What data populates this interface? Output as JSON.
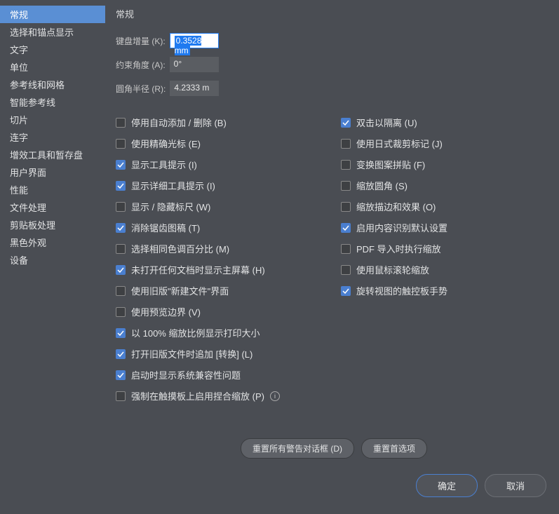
{
  "sidebar": {
    "items": [
      {
        "label": "常规",
        "active": true
      },
      {
        "label": "选择和锚点显示"
      },
      {
        "label": "文字"
      },
      {
        "label": "单位"
      },
      {
        "label": "参考线和网格"
      },
      {
        "label": "智能参考线"
      },
      {
        "label": "切片"
      },
      {
        "label": "连字"
      },
      {
        "label": "增效工具和暂存盘"
      },
      {
        "label": "用户界面"
      },
      {
        "label": "性能"
      },
      {
        "label": "文件处理"
      },
      {
        "label": "剪贴板处理"
      },
      {
        "label": "黑色外观"
      },
      {
        "label": "设备"
      }
    ]
  },
  "main": {
    "title": "常规",
    "fields": {
      "keyboard_increment_label": "键盘增量 (K):",
      "keyboard_increment_value": "0.3528 mm",
      "constrain_angle_label": "约束角度 (A):",
      "constrain_angle_value": "0°",
      "corner_radius_label": "圆角半径 (R):",
      "corner_radius_value": "4.2333 m"
    },
    "checks_left": [
      {
        "label": "停用自动添加 / 删除 (B)",
        "checked": false
      },
      {
        "label": "使用精确光标 (E)",
        "checked": false
      },
      {
        "label": "显示工具提示 (I)",
        "checked": true
      },
      {
        "label": "显示详细工具提示 (I)",
        "checked": true
      },
      {
        "label": "显示 / 隐藏标尺 (W)",
        "checked": false
      },
      {
        "label": "消除锯齿图稿 (T)",
        "checked": true
      },
      {
        "label": "选择相同色调百分比 (M)",
        "checked": false
      },
      {
        "label": "未打开任何文档时显示主屏幕 (H)",
        "checked": true
      },
      {
        "label": "使用旧版\"新建文件\"界面",
        "checked": false
      },
      {
        "label": "使用预览边界 (V)",
        "checked": false
      },
      {
        "label": "以 100% 缩放比例显示打印大小",
        "checked": true
      },
      {
        "label": "打开旧版文件时追加 [转换] (L)",
        "checked": true
      },
      {
        "label": "启动时显示系统兼容性问题",
        "checked": true
      },
      {
        "label": "强制在触摸板上启用捏合缩放 (P)",
        "checked": false,
        "info": true
      }
    ],
    "checks_right": [
      {
        "label": "双击以隔离 (U)",
        "checked": true
      },
      {
        "label": "使用日式裁剪标记 (J)",
        "checked": false
      },
      {
        "label": "变换图案拼贴 (F)",
        "checked": false
      },
      {
        "label": "缩放圆角 (S)",
        "checked": false
      },
      {
        "label": "缩放描边和效果 (O)",
        "checked": false
      },
      {
        "label": "启用内容识别默认设置",
        "checked": true
      },
      {
        "label": "PDF 导入时执行缩放",
        "checked": false
      },
      {
        "label": "使用鼠标滚轮缩放",
        "checked": false
      },
      {
        "label": "旋转视图的触控板手势",
        "checked": true
      }
    ],
    "reset_buttons": {
      "reset_warnings": "重置所有警告对话框 (D)",
      "reset_prefs": "重置首选项"
    }
  },
  "footer": {
    "ok": "确定",
    "cancel": "取消"
  }
}
